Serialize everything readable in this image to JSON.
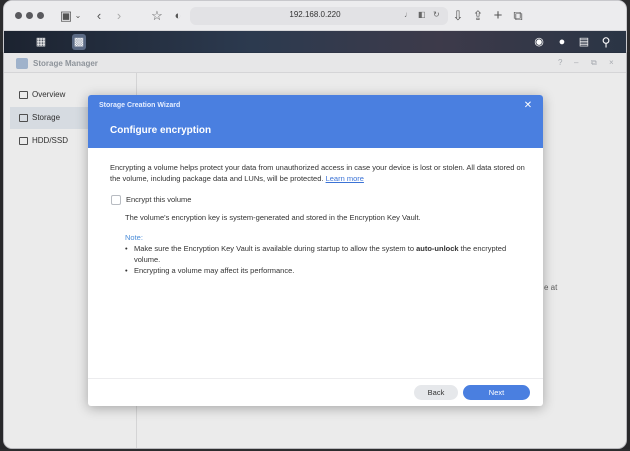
{
  "browser": {
    "address": "192.168.0.220",
    "icons": [
      "sidebar-icon",
      "chevron-down-icon",
      "back-icon",
      "forward-icon",
      "star-icon",
      "shield-icon",
      "speaker-icon",
      "translate-icon",
      "reload-icon",
      "download-icon",
      "share-icon",
      "plus-icon",
      "tabs-icon"
    ]
  },
  "window": {
    "title": "Storage Manager",
    "sidebar": [
      {
        "label": "Overview",
        "active": false
      },
      {
        "label": "Storage",
        "active": true
      },
      {
        "label": "HDD/SSD",
        "active": false
      }
    ],
    "background_fragment": "e at"
  },
  "dialog": {
    "wizard_title": "Storage Creation Wizard",
    "heading": "Configure encryption",
    "description": "Encrypting a volume helps protect your data from unauthorized access in case your device is lost or stolen. All data stored on the volume, including package data and LUNs, will be protected.",
    "learn_more": "Learn more",
    "checkbox_label": "Encrypt this volume",
    "checkbox_checked": false,
    "key_note": "The volume's encryption key is system-generated and stored in the Encryption Key Vault.",
    "note_heading": "Note:",
    "note_1_pre": "Make sure the Encryption Key Vault is available during startup to allow the system to ",
    "note_1_bold": "auto-unlock",
    "note_1_post": " the encrypted volume.",
    "note_2": "Encrypting a volume may affect its performance.",
    "back_label": "Back",
    "next_label": "Next"
  },
  "colors": {
    "accent": "#4a7fe0",
    "link": "#3b73d6",
    "note": "#4a8cd8"
  }
}
